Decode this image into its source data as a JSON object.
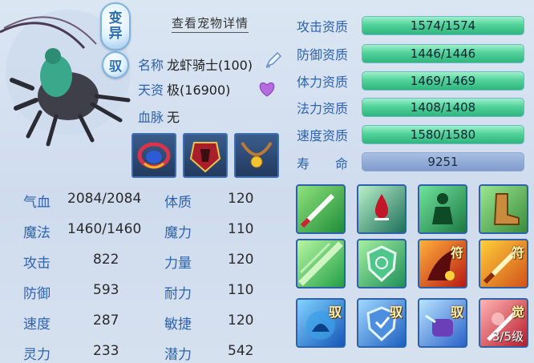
{
  "badges": {
    "mutate": "变\n异",
    "tame": "驭"
  },
  "view_details": "查看宠物详情",
  "info": {
    "name_label": "名称",
    "name_value": "龙虾骑士(100)",
    "aptitude_label": "天资",
    "aptitude_value": "极(16900)",
    "bloodline_label": "血脉",
    "bloodline_value": "无"
  },
  "stats": [
    {
      "label": "气血",
      "value": "2084/2084"
    },
    {
      "label": "魔法",
      "value": "1460/1460"
    },
    {
      "label": "攻击",
      "value": "822"
    },
    {
      "label": "防御",
      "value": "593"
    },
    {
      "label": "速度",
      "value": "287"
    },
    {
      "label": "灵力",
      "value": "233"
    }
  ],
  "attributes": [
    {
      "label": "体质",
      "value": "120"
    },
    {
      "label": "魔力",
      "value": "110"
    },
    {
      "label": "力量",
      "value": "120"
    },
    {
      "label": "耐力",
      "value": "110"
    },
    {
      "label": "敏捷",
      "value": "120"
    },
    {
      "label": "潜力",
      "value": "542"
    }
  ],
  "aptitudes": [
    {
      "label": "攻击资质",
      "value": "1574/1574"
    },
    {
      "label": "防御资质",
      "value": "1446/1446"
    },
    {
      "label": "体力资质",
      "value": "1469/1469"
    },
    {
      "label": "法力资质",
      "value": "1408/1408"
    },
    {
      "label": "速度资质",
      "value": "1580/1580"
    }
  ],
  "life": {
    "label": "寿　　命",
    "value": "9251"
  },
  "skills_tags": {
    "fu": "符",
    "yu": "驭",
    "jue": "觉"
  },
  "skill_level": "3/5级",
  "colors": {
    "accent": "#2f63ad",
    "bar_green": "#52d29b",
    "panel": "#cfdcee"
  }
}
